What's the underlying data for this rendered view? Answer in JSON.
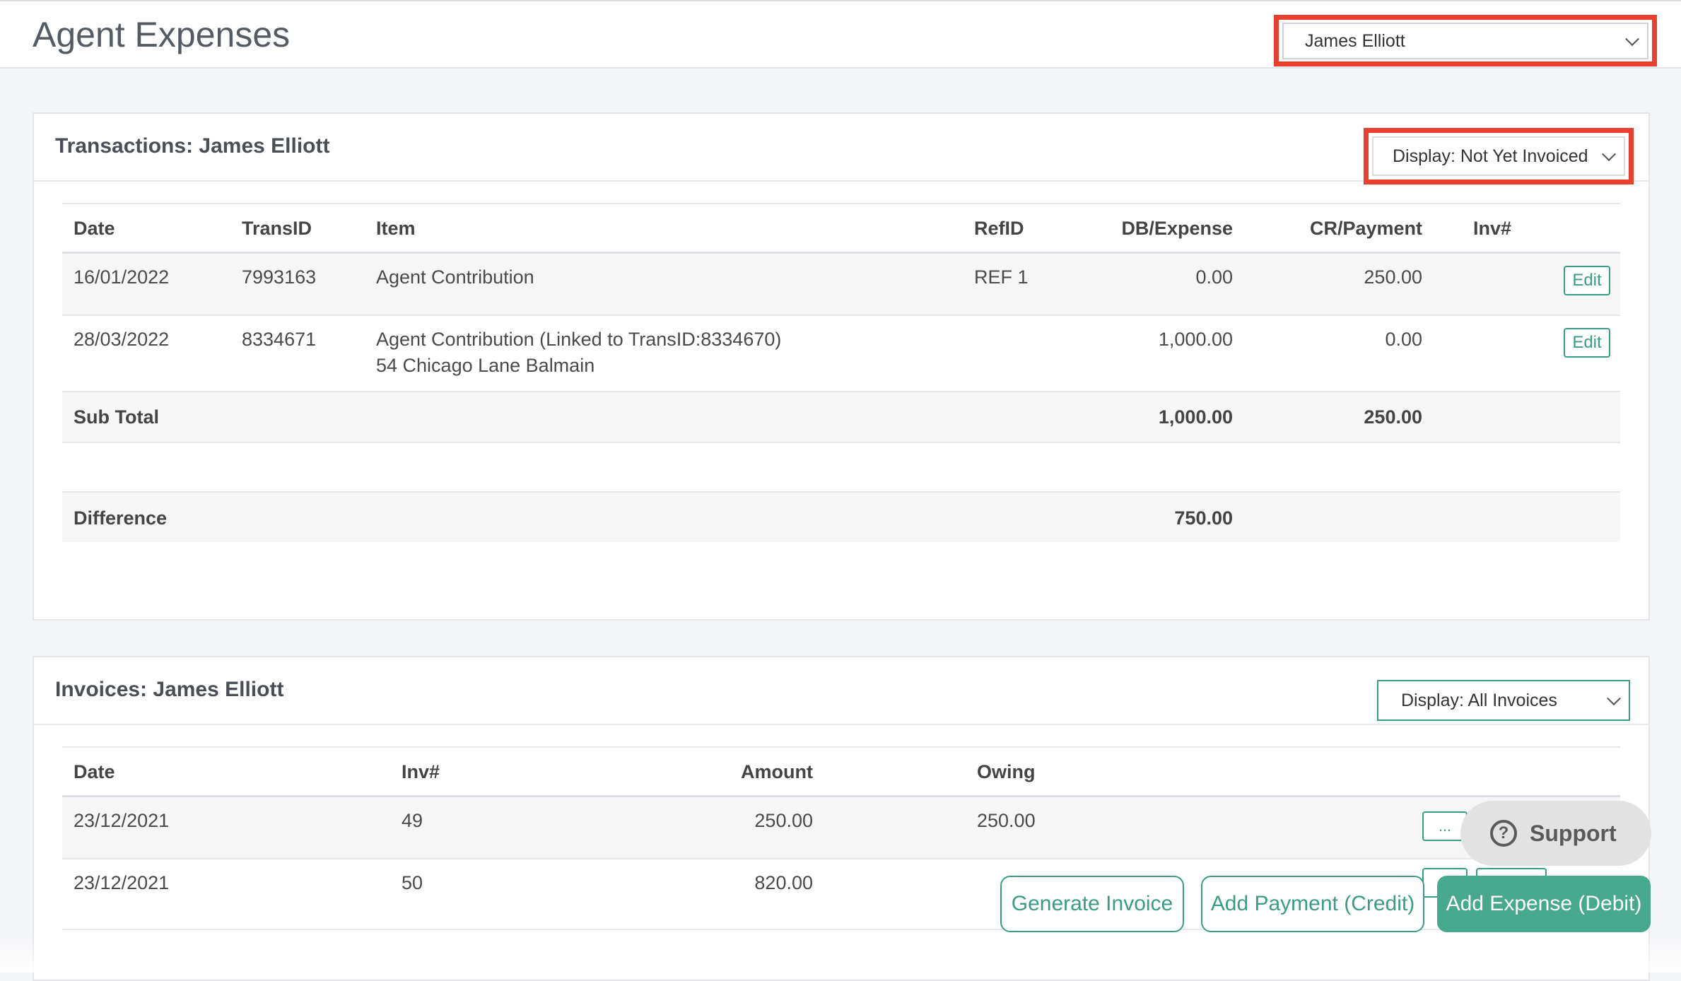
{
  "header": {
    "title": "Agent Expenses",
    "agent_select": "James Elliott"
  },
  "transactions": {
    "title": "Transactions: James Elliott",
    "display_select": "Display: Not Yet Invoiced",
    "columns": [
      "Date",
      "TransID",
      "Item",
      "RefID",
      "DB/Expense",
      "CR/Payment",
      "Inv#"
    ],
    "rows": [
      {
        "date": "16/01/2022",
        "trans_id": "7993163",
        "item": "Agent Contribution",
        "item2": "",
        "ref_id": "REF 1",
        "db": "0.00",
        "cr": "250.00",
        "inv": "",
        "action": "Edit"
      },
      {
        "date": "28/03/2022",
        "trans_id": "8334671",
        "item": "Agent Contribution (Linked to TransID:8334670)",
        "item2": "54 Chicago Lane Balmain",
        "ref_id": "",
        "db": "1,000.00",
        "cr": "0.00",
        "inv": "",
        "action": "Edit"
      }
    ],
    "subtotal": {
      "label": "Sub Total",
      "db": "1,000.00",
      "cr": "250.00"
    },
    "difference": {
      "label": "Difference",
      "db": "750.00"
    }
  },
  "invoices": {
    "title": "Invoices: James Elliott",
    "display_select": "Display: All Invoices",
    "columns": [
      "Date",
      "Inv#",
      "Amount",
      "Owing"
    ],
    "rows": [
      {
        "date": "23/12/2021",
        "inv": "49",
        "amount": "250.00",
        "owing": "250.00",
        "action": "..."
      },
      {
        "date": "23/12/2021",
        "inv": "50",
        "amount": "820.00",
        "owing": "",
        "action": ""
      }
    ]
  },
  "actions": {
    "generate_invoice": "Generate Invoice",
    "add_payment": "Add Payment (Credit)",
    "add_expense": "Add Expense (Debit)"
  },
  "support": {
    "label": "Support",
    "icon": "question-circle-icon"
  },
  "colors": {
    "accent": "#46a88c",
    "highlight": "#e8402c"
  }
}
